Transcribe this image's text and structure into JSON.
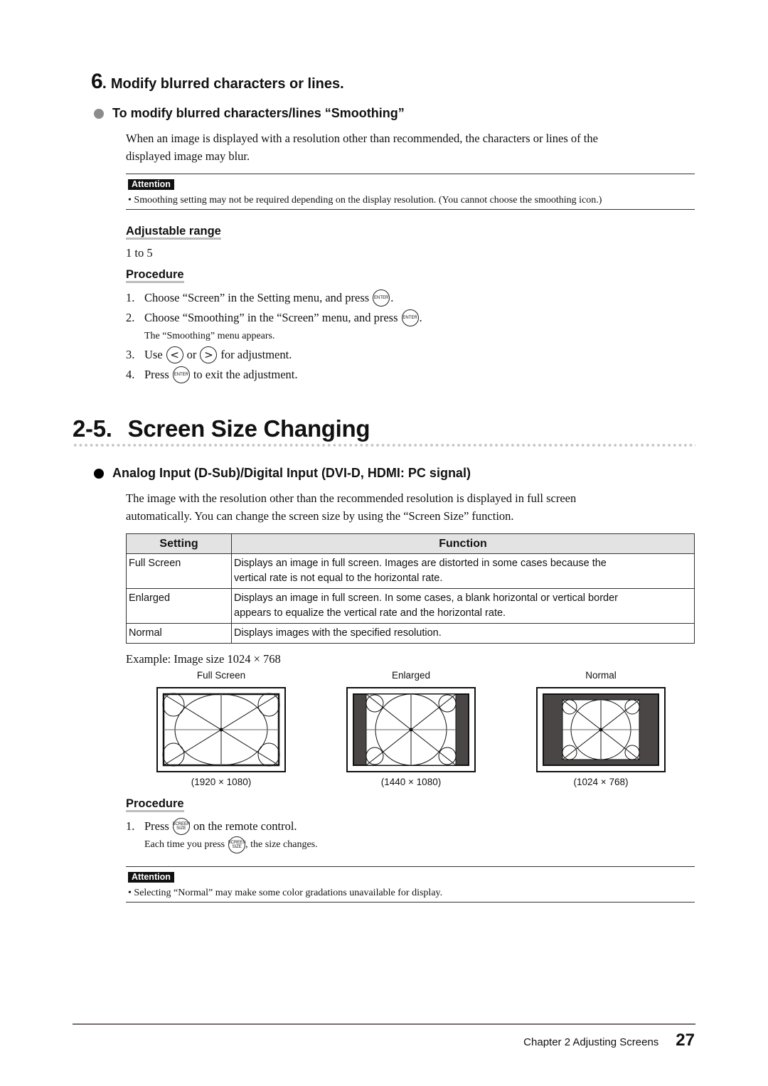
{
  "step6": {
    "number": "6",
    "title": "Modify blurred characters or lines.",
    "bullet_heading": "To modify blurred characters/lines “Smoothing”",
    "bullet_color": "#8c8c8c",
    "intro_line1": "When an image is displayed with a resolution other than recommended, the characters or lines of the",
    "intro_line2": "displayed image may blur.",
    "attention": {
      "label": "Attention",
      "text": "•  Smoothing setting may not be required depending on the display resolution. (You cannot choose the smoothing icon.)"
    },
    "range_heading": "Adjustable range",
    "range_value": "1 to 5",
    "procedure_heading": "Procedure",
    "steps": [
      {
        "num": "1.",
        "before": "Choose “Screen” in the Setting menu, and press",
        "icon": "enter-button",
        "after": "."
      },
      {
        "num": "2.",
        "before": "Choose “Smoothing” in the “Screen” menu, and press",
        "icon": "enter-button",
        "after": "."
      },
      {
        "note": "The “Smoothing” menu appears."
      },
      {
        "num": "3.",
        "before": "Use",
        "mid": "or",
        "after": "for adjustment."
      },
      {
        "num": "4.",
        "before": "Press",
        "icon": "enter-button",
        "after": "to exit the adjustment."
      }
    ]
  },
  "icons": {
    "enter_label": "ENTER",
    "screen_size_line1": "SCREEN",
    "screen_size_line2": "SIZE",
    "left_arrow": "<",
    "right_arrow": ">"
  },
  "section": {
    "number": "2-5.",
    "title": "Screen Size Changing",
    "bullet_heading": "Analog Input (D-Sub)/Digital Input (DVI-D, HDMI: PC signal)",
    "bullet_color": "#000000",
    "intro_line1": "The image with the resolution other than the recommended resolution is displayed in full screen",
    "intro_line2": "automatically. You can change the screen size by using the “Screen Size” function.",
    "table": {
      "headers": [
        "Setting",
        "Function"
      ],
      "rows": [
        {
          "setting": "Full Screen",
          "function_line1": "Displays an image in full screen. Images are distorted in some cases because the",
          "function_line2": "vertical rate is not equal to the horizontal rate."
        },
        {
          "setting": "Enlarged",
          "function_line1": "Displays an image in full screen. In some cases, a blank horizontal or vertical border",
          "function_line2": "appears to equalize the vertical rate and the horizontal rate."
        },
        {
          "setting": "Normal",
          "function_line1": "Displays images with the specified resolution.",
          "function_line2": ""
        }
      ]
    },
    "example_label": "Example: Image size 1024 × 768",
    "examples": [
      {
        "name": "Full Screen",
        "resolution": "(1920 × 1080)"
      },
      {
        "name": "Enlarged",
        "resolution": "(1440 × 1080)"
      },
      {
        "name": "Normal",
        "resolution": "(1024 × 768)"
      }
    ],
    "border_fill_color": "#4a4646",
    "procedure_heading": "Procedure",
    "step1_num": "1.",
    "step1_before": "Press",
    "step1_after": "on the remote control.",
    "step1_note_before": "Each time you press",
    "step1_note_after": ", the size changes.",
    "attention": {
      "label": "Attention",
      "text": "•  Selecting “Normal” may make some color gradations unavailable for display."
    }
  },
  "footer": {
    "chapter": "Chapter 2 Adjusting Screens",
    "page": "27"
  }
}
